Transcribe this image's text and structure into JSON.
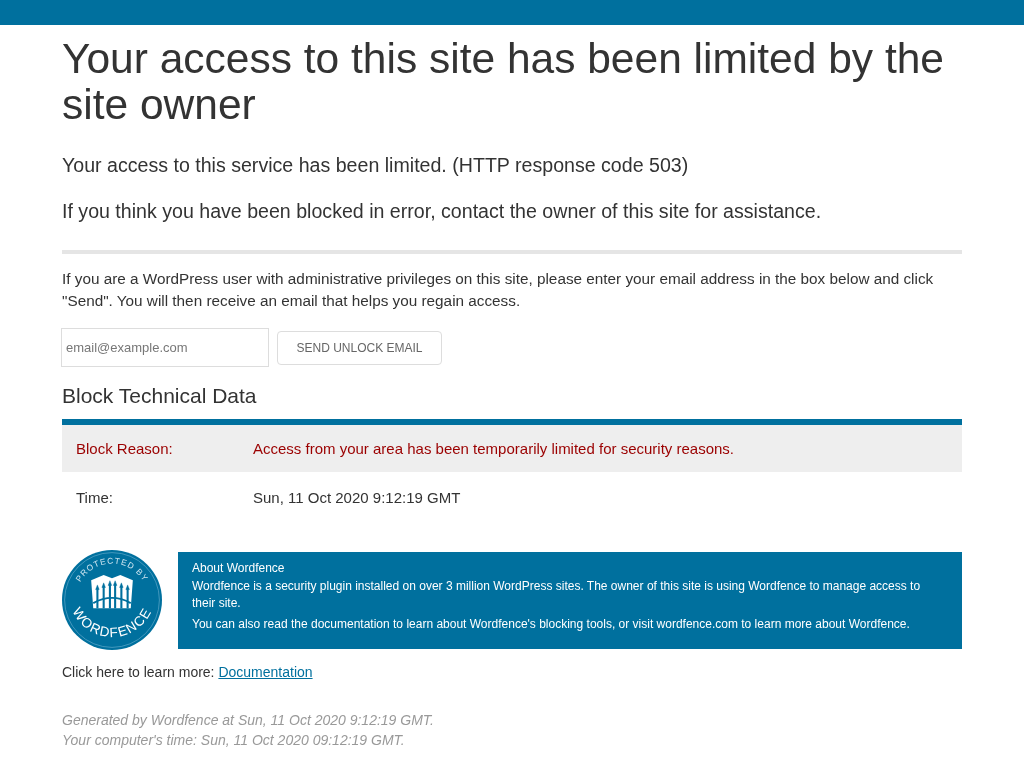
{
  "heading": "Your access to this site has been limited by the site owner",
  "messages": [
    "Your access to this service has been limited. (HTTP response code 503)",
    "If you think you have been blocked in error, contact the owner of this site for assistance."
  ],
  "admin_notice": "If you are a WordPress user with administrative privileges on this site, please enter your email address in the box below and click \"Send\". You will then receive an email that helps you regain access.",
  "unlock_form": {
    "placeholder": "email@example.com",
    "button": "SEND UNLOCK EMAIL"
  },
  "technical_data": {
    "title": "Block Technical Data",
    "rows": [
      {
        "kind": "alert",
        "label": "Block Reason:",
        "value": "Access from your area has been temporarily limited for security reasons."
      },
      {
        "kind": "plain",
        "label": "Time:",
        "value": "Sun, 11 Oct 2020 9:12:19 GMT"
      }
    ]
  },
  "about": {
    "logo": {
      "top_text": "PROTECTED BY",
      "bottom_text": "WORDFENCE"
    },
    "title": "About Wordfence",
    "paragraphs": [
      "Wordfence is a security plugin installed on over 3 million WordPress sites. The owner of this site is using Wordfence to manage access to their site.",
      "You can also read the documentation to learn about Wordfence's blocking tools, or visit wordfence.com to learn more about Wordfence."
    ]
  },
  "learn_more": {
    "text": "Click here to learn more:",
    "link": "Documentation"
  },
  "footer": [
    "Generated by Wordfence at Sun, 11 Oct 2020 9:12:19 GMT.",
    "Your computer's time: Sun, 11 Oct 2020 09:12:19 GMT."
  ]
}
